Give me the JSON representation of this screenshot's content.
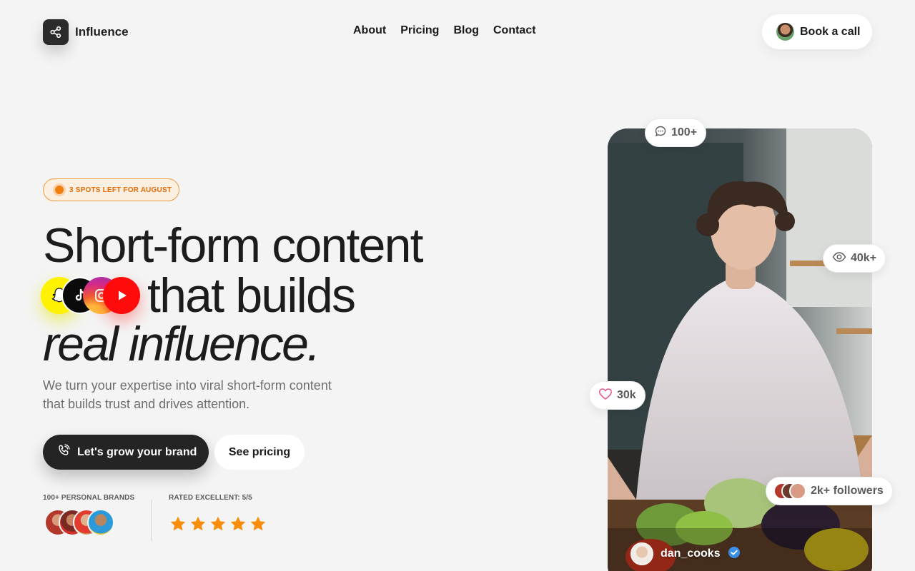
{
  "brand": {
    "name": "Influence",
    "logo_icon": "share-icon"
  },
  "nav": {
    "items": [
      "About",
      "Pricing",
      "Blog",
      "Contact"
    ]
  },
  "header": {
    "book_call_label": "Book a call"
  },
  "hero": {
    "badge": "3 SPOTS LEFT FOR AUGUST",
    "headline_line1": "Short-form content",
    "headline_line2": "that builds",
    "headline_line3": "real influence.",
    "subtitle": "We turn your expertise into viral short-form content that builds trust and drives attention.",
    "cta_primary": "Let's grow your brand",
    "cta_secondary": "See pricing",
    "social_icons": [
      "snapchat-icon",
      "tiktok-icon",
      "instagram-icon",
      "youtube-icon"
    ]
  },
  "proof": {
    "brands_label": "100+ PERSONAL BRANDS",
    "rating_label": "RATED EXCELLENT: 5/5",
    "rating": 5,
    "rating_max": 5
  },
  "video_card": {
    "comments": "100+",
    "views": "40k+",
    "likes": "30k",
    "followers": "2k+ followers",
    "username": "dan_cooks",
    "verified": true
  },
  "colors": {
    "accent_orange": "#f07f10",
    "dark": "#242424",
    "background": "#f4f4f4",
    "star": "#f88d0c",
    "verified_blue": "#3b8fe8",
    "heart_pink": "#e8548c"
  }
}
